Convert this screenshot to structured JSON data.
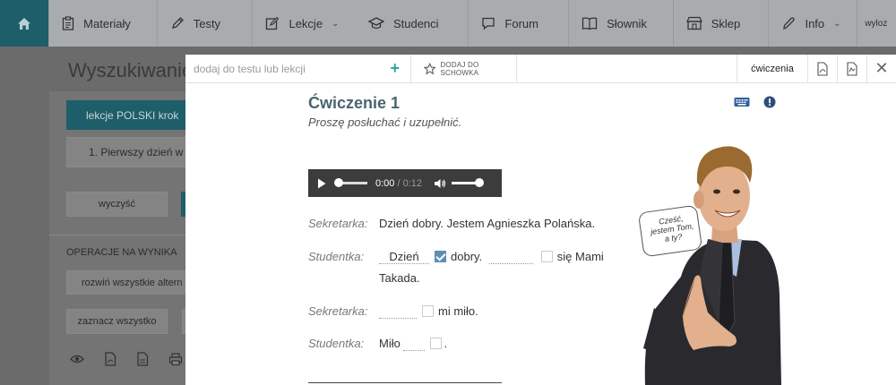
{
  "nav": {
    "items": [
      {
        "label": "Materiały",
        "icon": "clipboard-icon"
      },
      {
        "label": "Testy",
        "icon": "pencil-icon"
      },
      {
        "label": "Lekcje",
        "icon": "edit-icon"
      },
      {
        "label": "Studenci",
        "icon": "graduation-cap-icon"
      },
      {
        "label": "Forum",
        "icon": "chat-icon"
      },
      {
        "label": "Słownik",
        "icon": "book-icon"
      },
      {
        "label": "Sklep",
        "icon": "shop-icon"
      },
      {
        "label": "Info",
        "icon": "pen-icon"
      }
    ],
    "user_fragment": "wyloz"
  },
  "background": {
    "title": "Wyszukiwanie m",
    "filter_tab": "lekcje POLSKI krok",
    "lesson_select": "1. Pierwszy dzień w",
    "clear_button": "wyczyść",
    "ops_label": "OPERACJE NA WYNIKA",
    "expand_button": "rozwiń wszystkie altern",
    "select_all_button": "zaznacz wszystko"
  },
  "modal": {
    "add_placeholder": "dodaj do testu lub lekcji",
    "clipboard_label": "DODAJ DO SCHOWKA",
    "type_label": "ćwiczenia",
    "exercise_title": "Ćwiczenie 1",
    "exercise_instruction": "Proszę posłuchać i uzupełnić.",
    "audio": {
      "current": "0:00",
      "separator": " / ",
      "duration": "0:12",
      "progress": 0,
      "volume": 1.0
    },
    "dialogue": {
      "line1": {
        "speaker": "Sekretarka:",
        "text": "Dzień dobry. Jestem Agnieszka Polańska."
      },
      "line2": {
        "speaker": "Studentka:",
        "gap1": "Dzień",
        "word1": "dobry.",
        "word2": "się Mami",
        "word3": "Takada."
      },
      "line3": {
        "speaker": "Sekretarka:",
        "word1": "mi miło."
      },
      "line4": {
        "speaker": "Studentka:",
        "word1": "Miło",
        "word2": "."
      }
    },
    "speech_bubble": "Cześć, jestem Tom, a ty?"
  }
}
